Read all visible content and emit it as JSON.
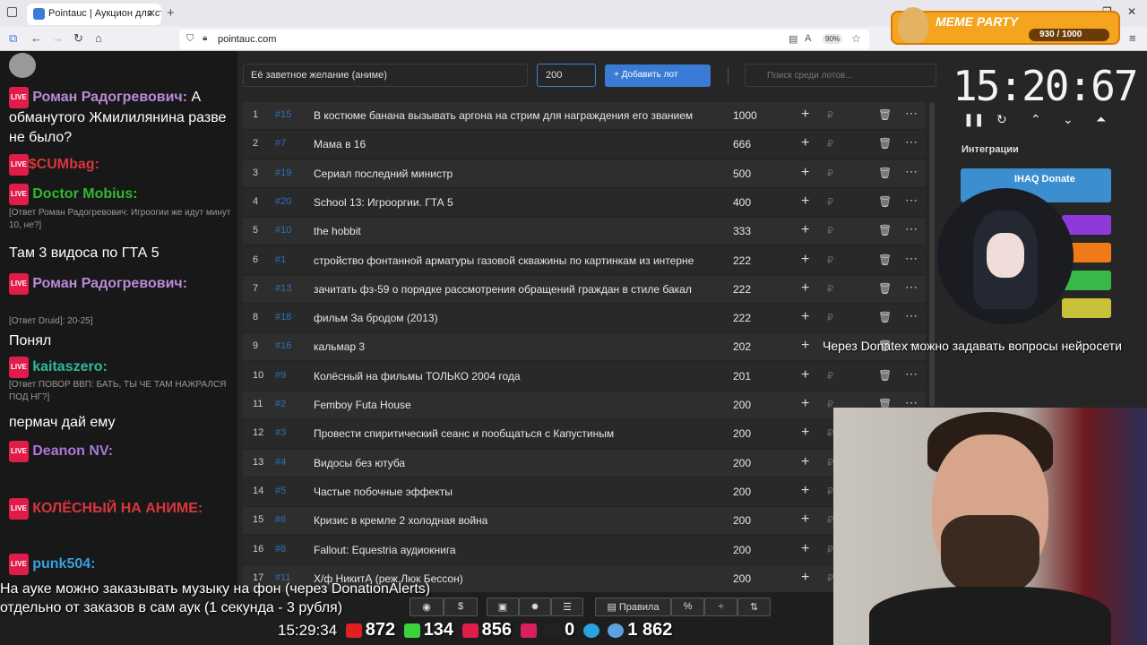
{
  "browser": {
    "tab_title": "Pointauc | Аукцион для стримеров",
    "url": "pointauc.com",
    "zoom": "90%"
  },
  "overlay": {
    "meme_title": "MEME PARTY",
    "meme_progress": "930 / 1000"
  },
  "chat": [
    {
      "type": "msg",
      "name": "Роман Радогревович:",
      "text": "А обманутого Жмилилянина разве не было?",
      "color": "#b88ad8"
    },
    {
      "type": "msg",
      "name": "$CUMbag:",
      "text": "",
      "color": "#d8363c"
    },
    {
      "type": "msg",
      "name": "Doctor Mobius:",
      "text": "",
      "color": "#2fb82f"
    },
    {
      "type": "reply",
      "text": "[Ответ Роман Радогревович: Игроогии же идут минут 10, не?]"
    },
    {
      "type": "plain",
      "text": "Там 3 видоса по ГТА 5"
    },
    {
      "type": "msg",
      "name": "Роман Радогревович:",
      "text": "",
      "color": "#b88ad8"
    },
    {
      "type": "reply",
      "text": "[Ответ Druid]: 20-25]"
    },
    {
      "type": "plain",
      "text": "Понял"
    },
    {
      "type": "msg",
      "name": "kaitaszero:",
      "text": "",
      "color": "#2fb89a"
    },
    {
      "type": "reply",
      "text": "[Ответ ПОВОР ВВП: БАТЬ, ТЫ ЧЕ ТАМ НАЖРАЛСЯ ПОД НГ?]"
    },
    {
      "type": "plain",
      "text": "пермач дай ему"
    },
    {
      "type": "msg",
      "name": "Deanon NV:",
      "text": "",
      "color": "#a878d8"
    },
    {
      "type": "msg",
      "name": "КОЛЁСНЫЙ НА АНИМЕ:",
      "text": "",
      "color": "#d8363c"
    },
    {
      "type": "msg",
      "name": "punk504:",
      "text": "",
      "color": "#3a9fe0"
    }
  ],
  "form": {
    "lot_name": "Её заветное желание (аниме)",
    "amount": "200",
    "add_button": "+ Добавить лот",
    "search_placeholder": "Поиск среди лотов..."
  },
  "lots": [
    {
      "n": "1",
      "id": "#15",
      "text": "В костюме банана вызывать аргона на стрим для награждения его званием",
      "amount": "1000"
    },
    {
      "n": "2",
      "id": "#7",
      "text": "Мама в 16",
      "amount": "666"
    },
    {
      "n": "3",
      "id": "#19",
      "text": "Сериал последний министр",
      "amount": "500"
    },
    {
      "n": "4",
      "id": "#20",
      "text": "School 13: Игрооргии. ГТА 5",
      "amount": "400"
    },
    {
      "n": "5",
      "id": "#10",
      "text": "the hobbit",
      "amount": "333"
    },
    {
      "n": "6",
      "id": "#1",
      "text": "стройство фонтанной арматуры газовой скважины по картинкам из интерне",
      "amount": "222"
    },
    {
      "n": "7",
      "id": "#13",
      "text": "зачитать фз-59 о порядке рассмотрения обращений граждан в стиле бакал",
      "amount": "222"
    },
    {
      "n": "8",
      "id": "#18",
      "text": "фильм За бродом (2013)",
      "amount": "222"
    },
    {
      "n": "9",
      "id": "#16",
      "text": "кальмар 3",
      "amount": "202"
    },
    {
      "n": "10",
      "id": "#9",
      "text": "Колёсный на фильмы ТОЛЬКО 2004 года",
      "amount": "201"
    },
    {
      "n": "11",
      "id": "#2",
      "text": "Femboy Futa House",
      "amount": "200"
    },
    {
      "n": "12",
      "id": "#3",
      "text": "Провести спиритический сеанс и пообщаться с Капустиным",
      "amount": "200"
    },
    {
      "n": "13",
      "id": "#4",
      "text": "Видосы без ютуба",
      "amount": "200"
    },
    {
      "n": "14",
      "id": "#5",
      "text": "Частые побочные эффекты",
      "amount": "200"
    },
    {
      "n": "15",
      "id": "#6",
      "text": "Кризис в кремле 2 холодная война",
      "amount": "200"
    },
    {
      "n": "16",
      "id": "#8",
      "text": "Fallout: Equestria аудиокнига",
      "amount": "200"
    },
    {
      "n": "17",
      "id": "#11",
      "text": "Х/ф НикитА (реж.Люк Бессон)",
      "amount": "200"
    }
  ],
  "timer": {
    "value": "15:20:67"
  },
  "integrations": {
    "title": "Интеграции",
    "ihaq": "IHAQ Donate"
  },
  "overlay_text": {
    "donatex": "Через Donatex можно задавать вопросы нейросети",
    "line1": "На ауке можно заказывать музыку на фон (через DonationAlerts)",
    "line2": "отдельно от заказов в сам аук (1 секунда - 3 рубля)"
  },
  "toolbar": {
    "rules": "Правила",
    "percent": "%",
    "dollar": "$"
  },
  "stats": {
    "time": "15:29:34",
    "youtube": "872",
    "kick": "134",
    "vk": "856",
    "rutube": "0",
    "telegram": "",
    "viewers": "1 862"
  }
}
